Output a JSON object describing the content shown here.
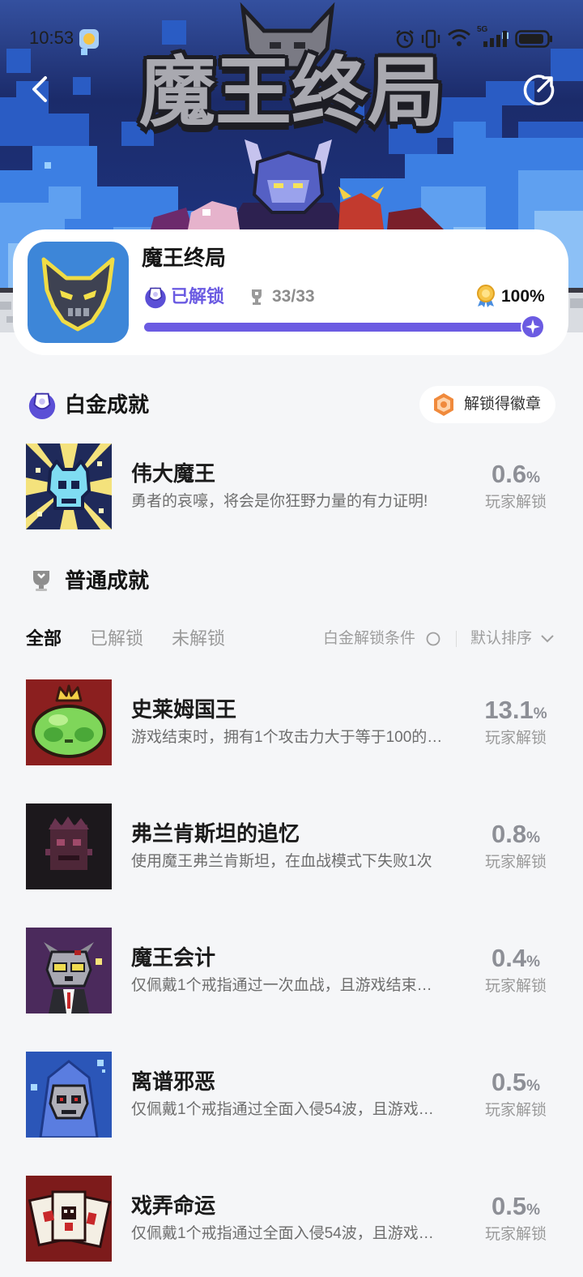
{
  "status_bar": {
    "time": "10:53",
    "network_label": "5G",
    "icons": [
      "weather-sun-icon",
      "alarm-icon",
      "vibrate-icon",
      "wifi-icon",
      "signal-icon",
      "battery-icon"
    ]
  },
  "header": {
    "logo_text": "魔王终局",
    "back_icon": "chevron-left-icon",
    "share_icon": "share-icon"
  },
  "game_card": {
    "title": "魔王终局",
    "unlock_status": "已解锁",
    "trophies": "33/33",
    "completion": "100%",
    "progress_fraction": 1.0,
    "accent_color": "#6B5BE2"
  },
  "platinum": {
    "section_title": "白金成就",
    "badge_button": "解锁得徽章",
    "item": {
      "title": "伟大魔王",
      "description": "勇者的哀嚎，将会是你狂野力量的有力证明!",
      "percent": "0.6"
    }
  },
  "normal": {
    "section_title": "普通成就"
  },
  "filters": {
    "tabs": [
      {
        "label": "全部",
        "active": true
      },
      {
        "label": "已解锁",
        "active": false
      },
      {
        "label": "未解锁",
        "active": false
      }
    ],
    "platinum_condition": "白金解锁条件",
    "sort": "默认排序"
  },
  "percent_unit": "%",
  "percent_caption": "玩家解锁",
  "achievements": [
    {
      "title": "史莱姆国王",
      "description": "游戏结束时，拥有1个攻击力大于等于100的…",
      "percent": "13.1"
    },
    {
      "title": "弗兰肯斯坦的追忆",
      "description": "使用魔王弗兰肯斯坦，在血战模式下失败1次",
      "percent": "0.8"
    },
    {
      "title": "魔王会计",
      "description": "仅佩戴1个戒指通过一次血战，且游戏结束…",
      "percent": "0.4"
    },
    {
      "title": "离谱邪恶",
      "description": "仅佩戴1个戒指通过全面入侵54波，且游戏…",
      "percent": "0.5"
    },
    {
      "title": "戏弄命运",
      "description": "仅佩戴1个戒指通过全面入侵54波，且游戏…",
      "percent": "0.5"
    }
  ]
}
